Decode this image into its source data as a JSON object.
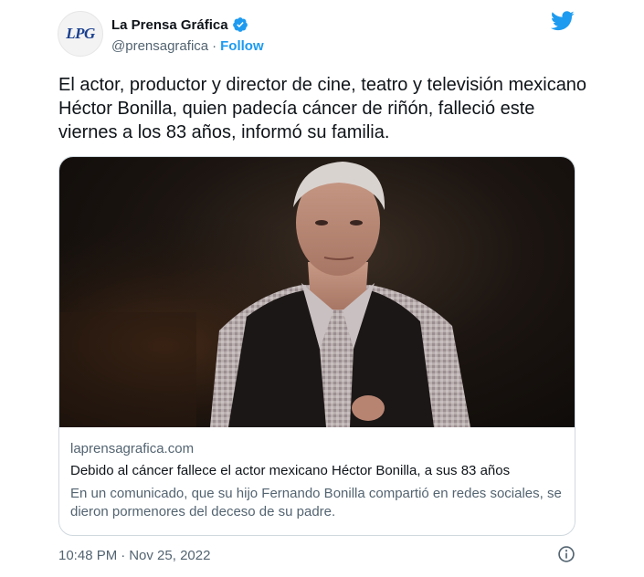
{
  "author": {
    "display_name": "La Prensa Gráfica",
    "handle": "@prensagrafica",
    "separator": "·",
    "follow_label": "Follow",
    "avatar_text": "LPG",
    "verified": true
  },
  "tweet": {
    "text": "El actor, productor y director de cine, teatro y televisión mexicano Héctor Bonilla, quien padecía cáncer de riñón, falleció este viernes a los 83 años, informó su familia."
  },
  "card": {
    "domain": "laprensagrafica.com",
    "title": "Debido al cáncer fallece el actor mexicano Héctor Bonilla, a sus 83 años",
    "description": "En un comunicado, que su hijo Fernando Bonilla compartió en redes sociales, se dieron pormenores del deceso de su padre."
  },
  "footer": {
    "time": "10:48 PM",
    "separator": "·",
    "date": "Nov 25, 2022"
  },
  "icons": {
    "brand": "twitter-bird-icon",
    "verified": "verified-badge-icon",
    "info": "info-icon"
  },
  "colors": {
    "twitter_blue": "#1d9bf0",
    "text_primary": "#0f1419",
    "text_secondary": "#536471",
    "border": "#cfd9de"
  }
}
